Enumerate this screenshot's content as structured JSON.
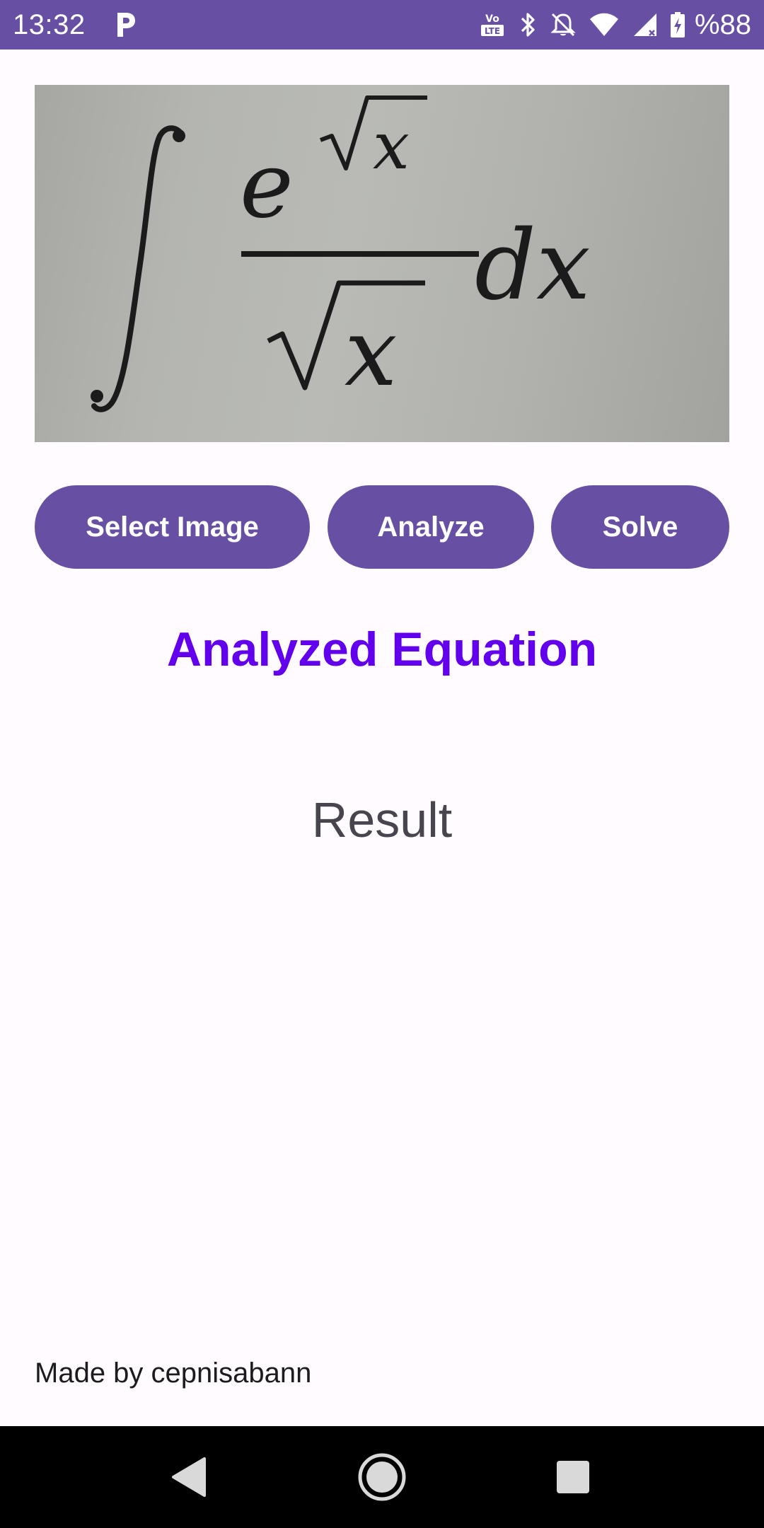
{
  "status_bar": {
    "time": "13:32",
    "battery_text": "%88",
    "icons": [
      "parking-icon",
      "volte-icon",
      "bluetooth-icon",
      "notifications-off-icon",
      "wifi-icon",
      "signal-icon",
      "battery-charging-icon"
    ]
  },
  "equation_image": {
    "description_icon": "equation-photo",
    "alt": ""
  },
  "buttons": {
    "select_image": "Select Image",
    "analyze": "Analyze",
    "solve": "Solve"
  },
  "analyzed_title": "Analyzed Equation",
  "result_text": "Result",
  "footer": {
    "credit": "Made by cepnisabann"
  },
  "nav_bar": {
    "icons": [
      "back-icon",
      "home-icon",
      "recents-icon"
    ]
  },
  "colors": {
    "primary": "#6750A4",
    "title_accent": "#6200EE",
    "background": "#FFFBFE",
    "result_text": "#49454F"
  }
}
